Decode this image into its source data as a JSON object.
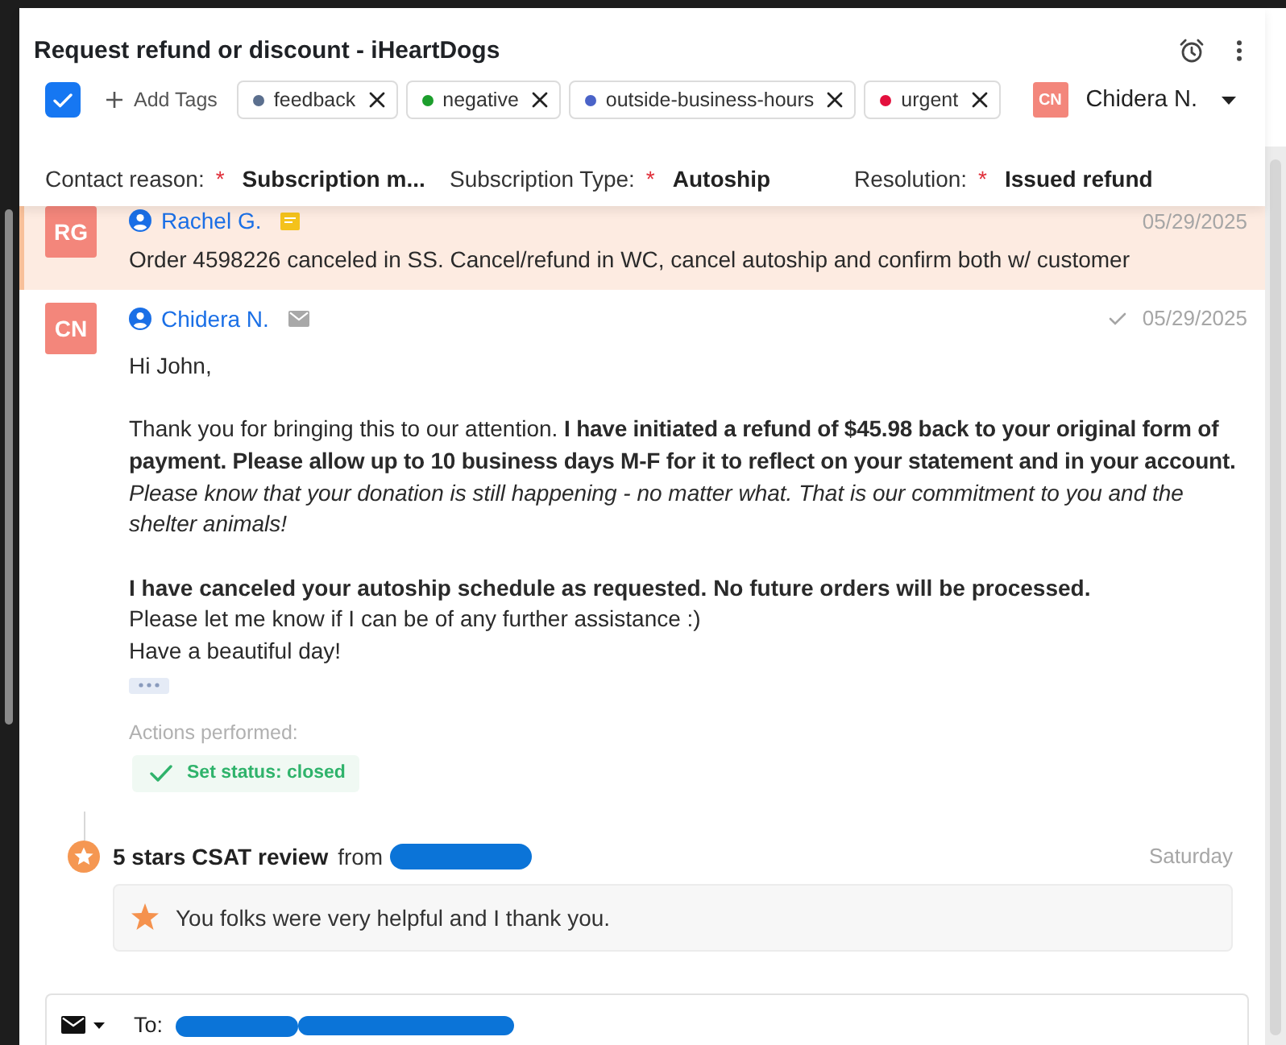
{
  "ticket": {
    "title": "Request refund or discount - iHeartDogs"
  },
  "toolbar": {
    "select_checked": true,
    "add_tags_label": "Add Tags",
    "tags": [
      {
        "label": "feedback",
        "color": "#5b6f8e"
      },
      {
        "label": "negative",
        "color": "#1c9e2c"
      },
      {
        "label": "outside-business-hours",
        "color": "#4a63c8"
      },
      {
        "label": "urgent",
        "color": "#e3103d"
      }
    ],
    "assignee": {
      "initials": "CN",
      "name": "Chidera N."
    }
  },
  "fields": [
    {
      "label": "Contact reason:",
      "required_mark": "*",
      "value": "Subscription m..."
    },
    {
      "label": "Subscription Type:",
      "required_mark": "*",
      "value": "Autoship"
    },
    {
      "label": "Resolution:",
      "required_mark": "*",
      "value": "Issued refund"
    }
  ],
  "thread": [
    {
      "kind": "note",
      "initials": "RG",
      "author": "Rachel G.",
      "delivered": false,
      "date": "05/29/2025",
      "body": [
        {
          "lines": [
            {
              "kind": "plain",
              "text": "Order 4598226 canceled in SS. Cancel/refund in WC, cancel autoship and confirm both w/ customer"
            }
          ]
        }
      ]
    },
    {
      "kind": "email",
      "initials": "CN",
      "author": "Chidera N.",
      "delivered": true,
      "date": "05/29/2025",
      "body": [
        {
          "lines": [
            {
              "kind": "plain",
              "text": "Hi John,"
            }
          ]
        },
        {
          "lines": [
            {
              "kind": "plain",
              "text": "Thank you for bringing this to our attention. **I have initiated a refund of $45.98 back to your original form of payment. Please allow up to 10 business days M-F for it to reflect on your statement and in your account.**"
            },
            {
              "kind": "aside",
              "text": "Please know that your donation is still happening - no matter what. That is our commitment to you and the shelter animals!"
            }
          ]
        },
        {
          "lines": [
            {
              "kind": "notice",
              "text": "I have canceled your autoship schedule as requested. No future orders will be processed."
            },
            {
              "kind": "plain",
              "text": "Please let me know if I can be of any further assistance :)"
            },
            {
              "kind": "plain",
              "text": "Have a beautiful day!"
            }
          ]
        }
      ],
      "quote_collapsed": true,
      "actions_label": "Actions performed:",
      "actions": [
        "Set status: closed"
      ]
    }
  ],
  "csat": {
    "title": "5 stars CSAT review",
    "from_label": "from",
    "date": "Saturday",
    "comment": "You folks were very helpful and I thank you."
  },
  "reply": {
    "to_label": "To:"
  }
}
